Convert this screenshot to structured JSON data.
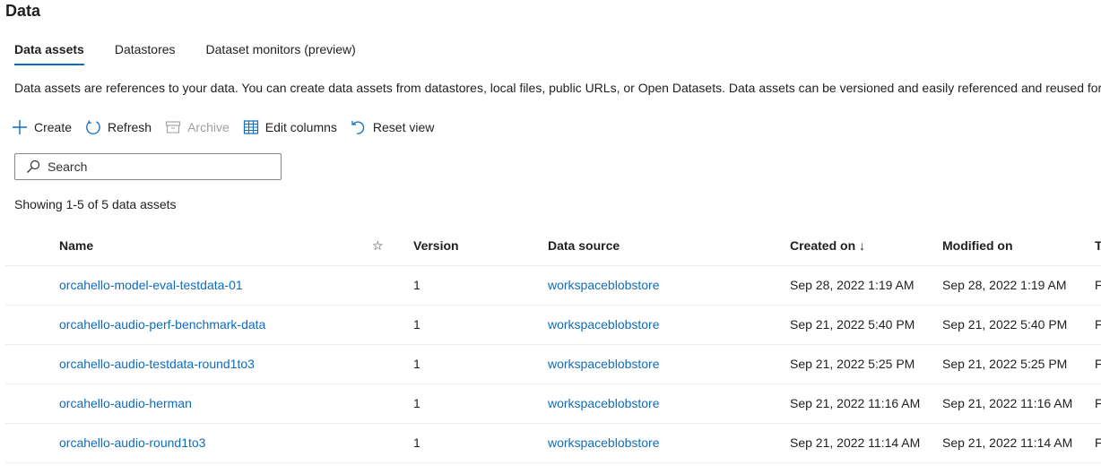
{
  "page": {
    "title": "Data",
    "description": "Data assets are references to your data. You can create data assets from datastores, local files, public URLs, or Open Datasets. Data assets can be versioned and easily referenced and reused for machine learning tasks."
  },
  "tabs": [
    {
      "label": "Data assets",
      "active": true
    },
    {
      "label": "Datastores",
      "active": false
    },
    {
      "label": "Dataset monitors (preview)",
      "active": false
    }
  ],
  "toolbar": {
    "create_label": "Create",
    "refresh_label": "Refresh",
    "archive_label": "Archive",
    "edit_columns_label": "Edit columns",
    "reset_view_label": "Reset view"
  },
  "search": {
    "placeholder": "Search",
    "value": ""
  },
  "count_text": "Showing 1-5 of 5 data assets",
  "table": {
    "columns": {
      "name": "Name",
      "favorite": "☆",
      "version": "Version",
      "data_source": "Data source",
      "created_on": "Created on",
      "created_sort": "↓",
      "modified_on": "Modified on",
      "type": "T"
    },
    "rows": [
      {
        "name": "orcahello-model-eval-testdata-01",
        "version": "1",
        "data_source": "workspaceblobstore",
        "created_on": "Sep 28, 2022 1:19 AM",
        "modified_on": "Sep 28, 2022 1:19 AM",
        "type": "F"
      },
      {
        "name": "orcahello-audio-perf-benchmark-data",
        "version": "1",
        "data_source": "workspaceblobstore",
        "created_on": "Sep 21, 2022 5:40 PM",
        "modified_on": "Sep 21, 2022 5:40 PM",
        "type": "F"
      },
      {
        "name": "orcahello-audio-testdata-round1to3",
        "version": "1",
        "data_source": "workspaceblobstore",
        "created_on": "Sep 21, 2022 5:25 PM",
        "modified_on": "Sep 21, 2022 5:25 PM",
        "type": "F"
      },
      {
        "name": "orcahello-audio-herman",
        "version": "1",
        "data_source": "workspaceblobstore",
        "created_on": "Sep 21, 2022 11:16 AM",
        "modified_on": "Sep 21, 2022 11:16 AM",
        "type": "F"
      },
      {
        "name": "orcahello-audio-round1to3",
        "version": "1",
        "data_source": "workspaceblobstore",
        "created_on": "Sep 21, 2022 11:14 AM",
        "modified_on": "Sep 21, 2022 11:14 AM",
        "type": "F"
      }
    ]
  },
  "colors": {
    "accent": "#0f6cbd",
    "text": "#201f1e",
    "disabled": "#a19f9d",
    "border": "#8a8886",
    "divider": "#edebe9"
  },
  "icons": {
    "create": "plus-icon",
    "refresh": "refresh-icon",
    "archive": "archive-icon",
    "edit_columns": "table-columns-icon",
    "reset_view": "reset-icon",
    "search": "search-icon"
  }
}
